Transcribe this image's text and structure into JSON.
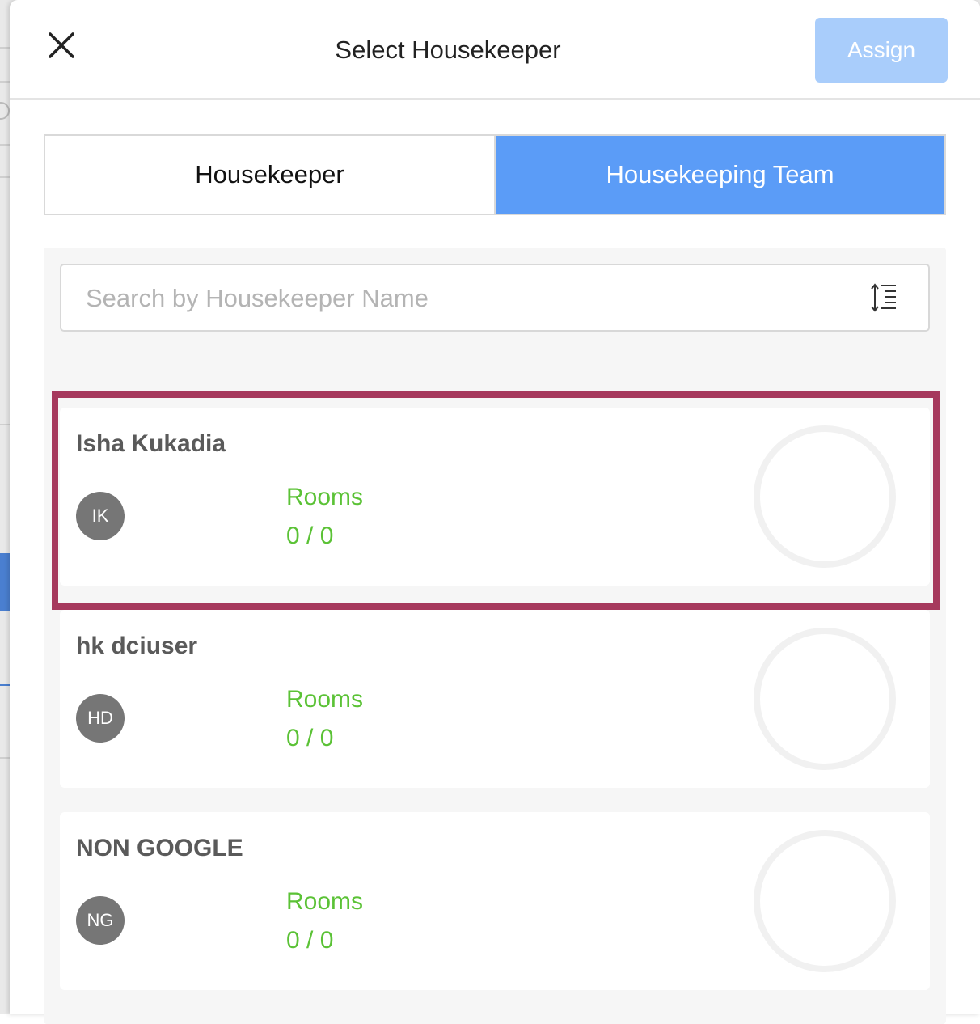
{
  "modal": {
    "title": "Select Housekeeper",
    "assign_label": "Assign"
  },
  "tabs": [
    {
      "label": "Housekeeper",
      "active": false
    },
    {
      "label": "Housekeeping Team",
      "active": true
    }
  ],
  "search": {
    "placeholder": "Search by Housekeeper Name",
    "value": ""
  },
  "housekeepers": [
    {
      "name": "Isha Kukadia",
      "initials": "IK",
      "rooms_label": "Rooms",
      "rooms_value": "0 / 0",
      "selected": true
    },
    {
      "name": "hk dciuser",
      "initials": "HD",
      "rooms_label": "Rooms",
      "rooms_value": "0 / 0",
      "selected": false
    },
    {
      "name": "NON GOOGLE",
      "initials": "NG",
      "rooms_label": "Rooms",
      "rooms_value": "0 / 0",
      "selected": false
    }
  ],
  "colors": {
    "accent": "#5b9cf7",
    "assign_disabled": "#a9cdfb",
    "rooms_text": "#5bc236",
    "avatar_bg": "#767676",
    "highlight": "#a6395d"
  },
  "icons": {
    "close": "close-icon",
    "sort": "sort-icon",
    "progress": "progress-ring-icon"
  }
}
